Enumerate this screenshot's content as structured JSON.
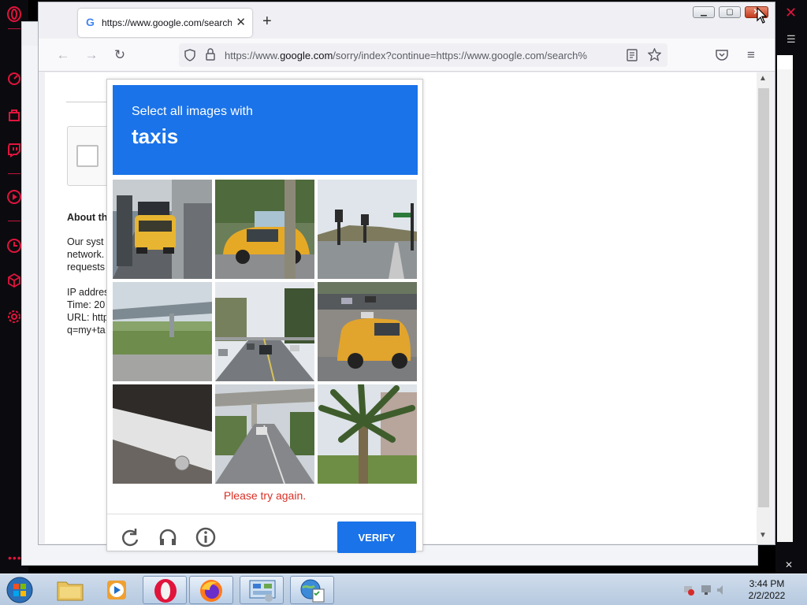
{
  "browser": {
    "tab": {
      "title": "https://www.google.com/search",
      "close_icon": "close-icon"
    },
    "new_tab_label": "+",
    "url": {
      "domain_prefix": "https://www.",
      "domain": "google.com",
      "path": "/sorry/index?continue=https://www.google.com/search%"
    },
    "window_controls": [
      "minimize",
      "maximize",
      "close"
    ]
  },
  "page": {
    "about_heading": "About th",
    "para": [
      "Our syst",
      "network.",
      "requests"
    ],
    "details": [
      "IP addres",
      "Time: 20",
      "URL: http",
      "q=my+ta"
    ]
  },
  "captcha": {
    "prompt_line1": "Select all images with",
    "prompt_keyword": "taxis",
    "tiles": [
      {
        "name": "tile-taxi-street-rear",
        "selected": false
      },
      {
        "name": "tile-taxi-side-view",
        "selected": false
      },
      {
        "name": "tile-traffic-lights-road",
        "selected": false
      },
      {
        "name": "tile-overpass-hedge",
        "selected": false
      },
      {
        "name": "tile-road-with-cars",
        "selected": false
      },
      {
        "name": "tile-taxi-suv-intersection",
        "selected": false
      },
      {
        "name": "tile-bus-side",
        "selected": false
      },
      {
        "name": "tile-overpass-road",
        "selected": false
      },
      {
        "name": "tile-palm-tree",
        "selected": false
      }
    ],
    "error_message": "Please try again.",
    "verify_label": "VERIFY",
    "colors": {
      "header": "#1a73e8",
      "error": "#d93025"
    }
  },
  "taskbar": {
    "items": [
      "windows-start",
      "file-explorer",
      "media-player",
      "opera",
      "firefox",
      "control-panel",
      "task-manager"
    ],
    "clock_time": "3:44 PM",
    "clock_date": "2/2/2022"
  }
}
